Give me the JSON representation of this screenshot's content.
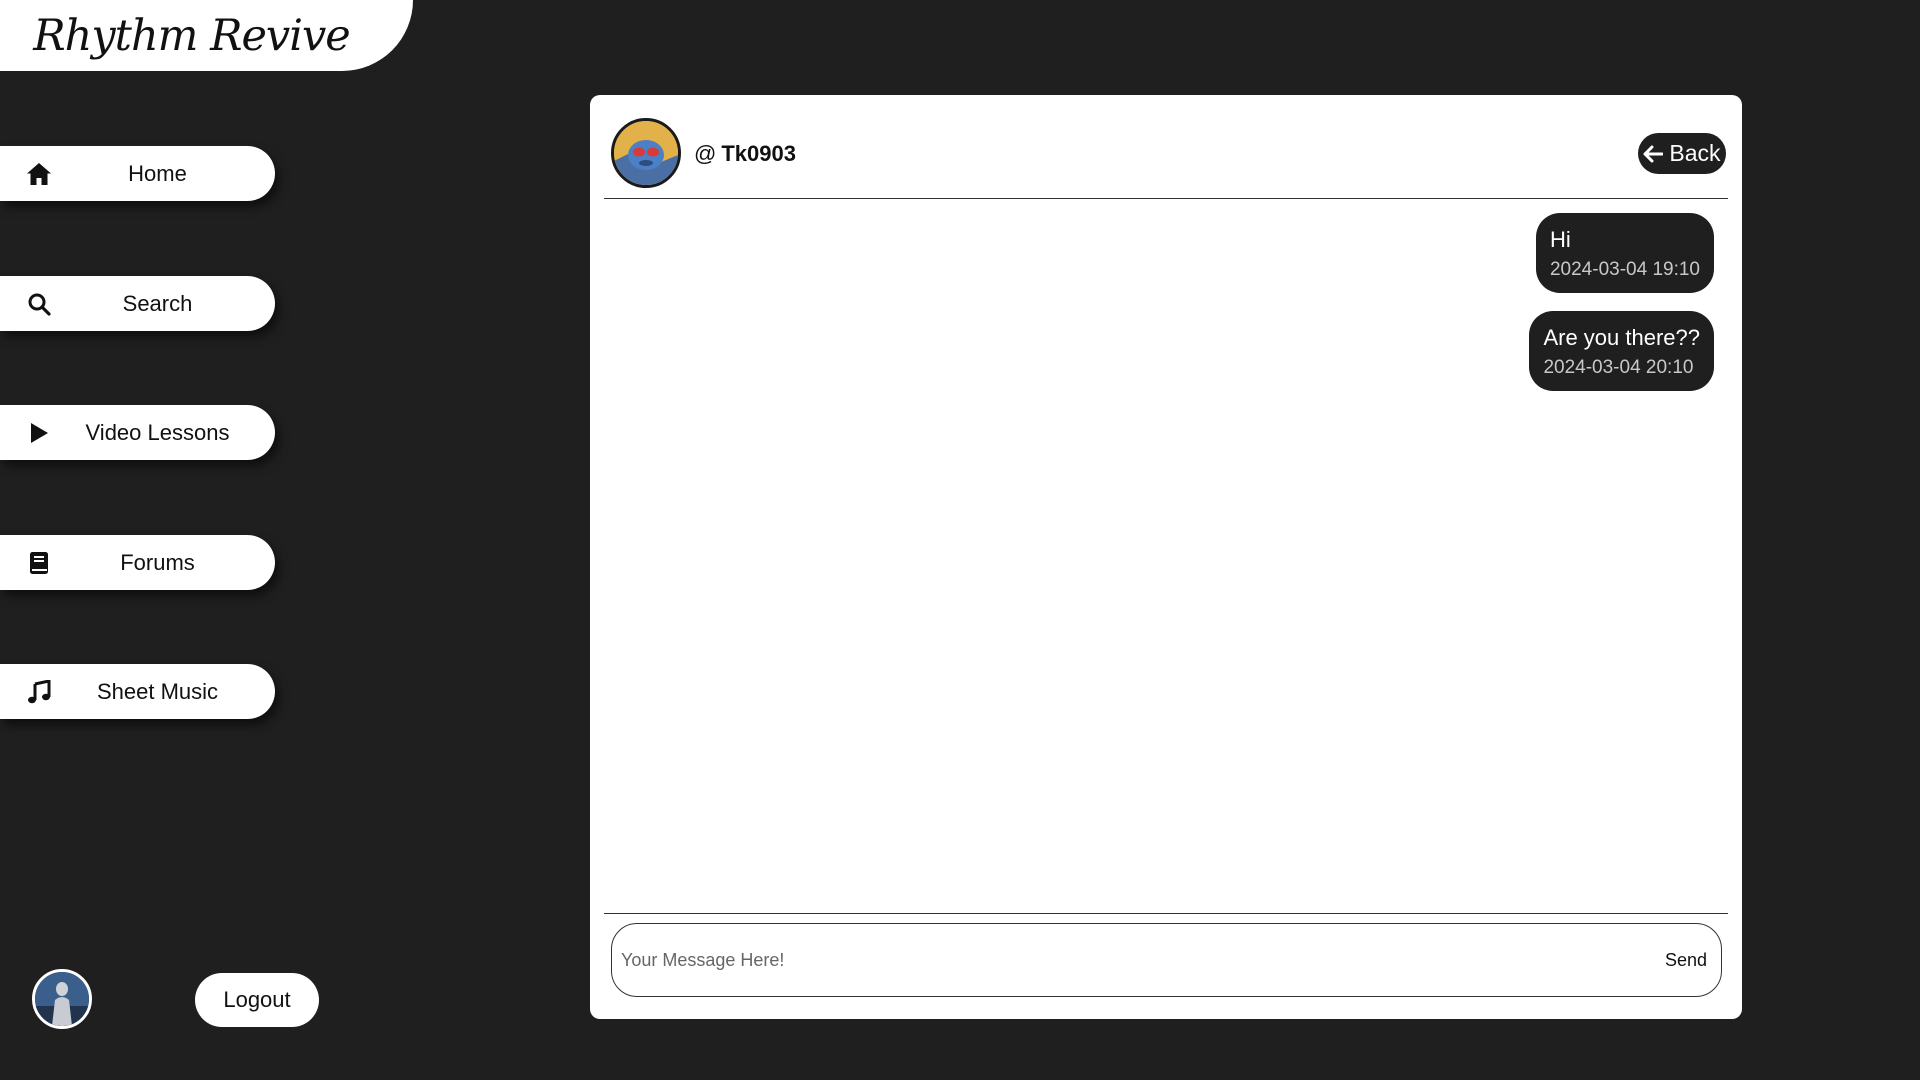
{
  "app": {
    "logo_text": "Rhythm Revive"
  },
  "sidebar": {
    "items": [
      {
        "label": "Home",
        "icon": "home-icon"
      },
      {
        "label": "Search",
        "icon": "search-icon"
      },
      {
        "label": "Video Lessons",
        "icon": "play-icon"
      },
      {
        "label": "Forums",
        "icon": "book-icon"
      },
      {
        "label": "Sheet Music",
        "icon": "music-note-icon"
      }
    ],
    "logout_label": "Logout"
  },
  "chat": {
    "peer": {
      "at": "@",
      "username": "Tk0903"
    },
    "back_label": "Back",
    "messages": [
      {
        "text": "Hi",
        "time": "2024-03-04 19:10"
      },
      {
        "text": "Are you there??",
        "time": "2024-03-04 20:10"
      }
    ],
    "composer": {
      "placeholder": "Your Message Here!",
      "value": "",
      "send_label": "Send"
    }
  },
  "colors": {
    "background": "#1f1f1f",
    "surface": "#ffffff",
    "bubble": "#1f1f1f"
  }
}
